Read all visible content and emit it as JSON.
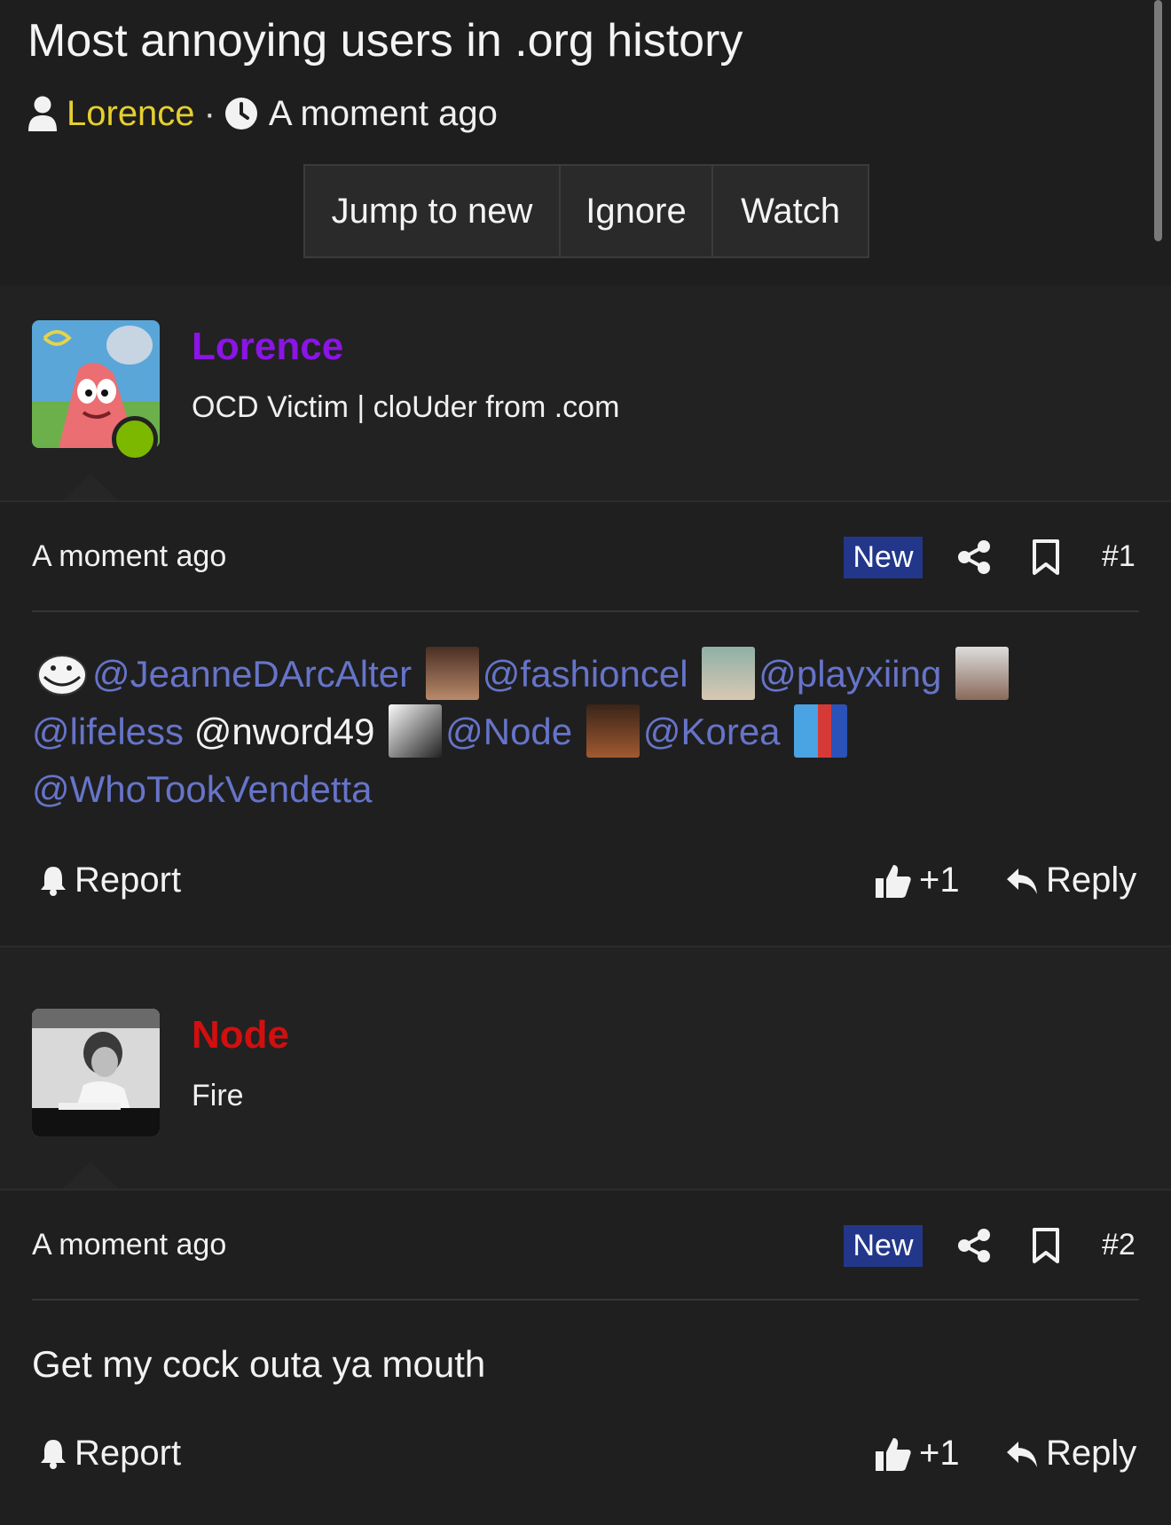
{
  "thread": {
    "title": "Most annoying users in .org history",
    "author": "Lorence",
    "separator": "·",
    "time": "A moment ago",
    "buttons": {
      "jump": "Jump to new",
      "ignore": "Ignore",
      "watch": "Watch"
    }
  },
  "posts": [
    {
      "author": {
        "name": "Lorence",
        "title": "OCD Victim | cloUder from .com",
        "name_color": "#8b14e6",
        "online": true
      },
      "time": "A moment ago",
      "badge": "New",
      "number": "#1",
      "content": {
        "items": [
          {
            "type": "mention",
            "text": "@JeanneDArcAlter"
          },
          {
            "type": "mention",
            "text": "@fashioncel"
          },
          {
            "type": "mention",
            "text": "@playxiing"
          },
          {
            "type": "mention",
            "text": "@lifeless"
          },
          {
            "type": "plain",
            "text": "@nword49"
          },
          {
            "type": "mention",
            "text": "@Node"
          },
          {
            "type": "mention",
            "text": "@Korea"
          },
          {
            "type": "mention",
            "text": "@WhoTookVendetta"
          }
        ]
      },
      "actions": {
        "report": "Report",
        "like": "+1",
        "reply": "Reply"
      }
    },
    {
      "author": {
        "name": "Node",
        "title": "Fire",
        "name_color": "#d20f0f",
        "online": false
      },
      "time": "A moment ago",
      "badge": "New",
      "number": "#2",
      "content": {
        "text": "Get my cock outa ya mouth"
      },
      "actions": {
        "report": "Report",
        "like": "+1",
        "reply": "Reply"
      }
    }
  ],
  "colors": {
    "background": "#222222",
    "accent_author": "#e6cf2e",
    "mention": "#6674c9",
    "badge_new": "#23378a",
    "online_dot": "#7db800"
  },
  "icons": [
    "user-icon",
    "clock-icon",
    "share-icon",
    "bookmark-icon",
    "bell-icon",
    "thumbs-up-icon",
    "reply-icon"
  ]
}
